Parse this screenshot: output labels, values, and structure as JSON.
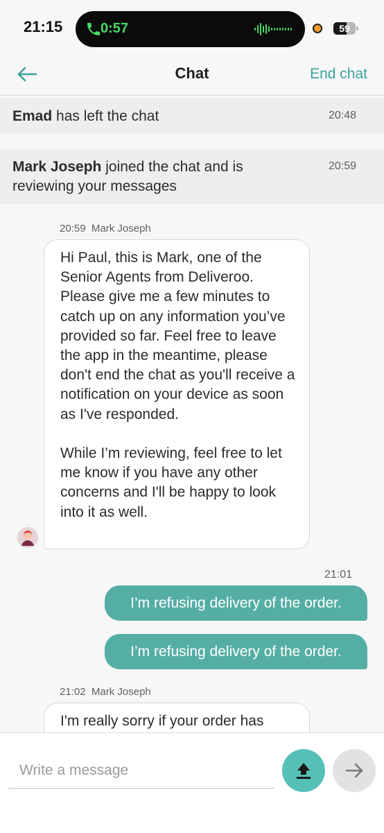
{
  "status_bar": {
    "time": "21:15",
    "call_timer": "0:57",
    "battery": {
      "level_percent": 59,
      "label": "59"
    },
    "call_color": "#4cd964",
    "recording_dot_color": "#f39a2b"
  },
  "nav": {
    "title": "Chat",
    "end_chat_label": "End chat",
    "back_icon": "arrow-left-icon",
    "accent_color": "#3aa39a"
  },
  "system_messages": [
    {
      "actor": "Emad",
      "text": " has left the chat",
      "time": "20:48"
    },
    {
      "actor": "Mark Joseph",
      "text": " joined the chat and is reviewing your messages",
      "time": "20:59"
    }
  ],
  "messages": [
    {
      "direction": "incoming",
      "time": "20:59",
      "sender": "Mark Joseph",
      "text": "Hi Paul, this is Mark, one of the Senior Agents from Deliveroo. Please give me a few minutes to catch up on any information you’ve provided so far. Feel free to leave the app in the meantime, please don't end the chat as you'll receive a notification on your device as soon as I've responded.\n\nWhile I’m reviewing, feel free to let me know if you have any other concerns and I'll be happy to look into it as well."
    },
    {
      "direction": "outgoing",
      "time": "21:01",
      "text": "I’m refusing delivery of the order."
    },
    {
      "direction": "outgoing",
      "text": "I’m refusing delivery of the order."
    },
    {
      "direction": "incoming",
      "time": "21:02",
      "sender": "Mark Joseph",
      "text": "I'm really sorry if your order has"
    }
  ],
  "composer": {
    "placeholder": "Write a message",
    "upload_icon": "upload-icon",
    "send_icon": "send-arrow-icon",
    "upload_color": "#55c0b6"
  },
  "colors": {
    "outgoing_bubble": "#55aea4",
    "background": "#f7f7f8",
    "system_row": "#eeeef0"
  }
}
